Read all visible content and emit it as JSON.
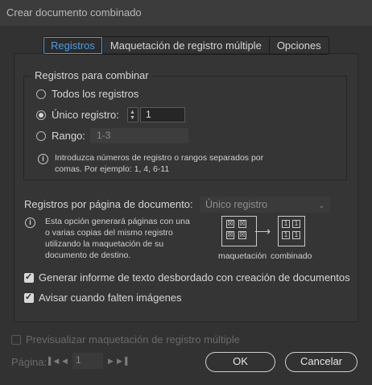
{
  "window": {
    "title": "Crear documento combinado"
  },
  "tabs": [
    {
      "label": "Registros",
      "active": true
    },
    {
      "label": "Maquetación de registro múltiple",
      "active": false
    },
    {
      "label": "Opciones",
      "active": false
    }
  ],
  "records_group": {
    "title": "Registros para combinar",
    "options": {
      "all": "Todos los registros",
      "single": "Único registro:",
      "range": "Rango:"
    },
    "selected": "single",
    "single_value": "1",
    "range_placeholder": "1-3",
    "info_line1": "Introduzca números de registro o rangos separados por",
    "info_line2": "comas. Por ejemplo: 1, 4, 6-11"
  },
  "per_page": {
    "label": "Registros por página de documento:",
    "value": "Único registro",
    "info_lines": [
      "Esta opción generará páginas con una",
      "o varias copias del mismo registro",
      "utilizando la maquetación de su",
      "documento de destino."
    ],
    "diagram_left_label": "maquetación",
    "diagram_right_label": "combinado"
  },
  "checkboxes": {
    "overset_report": {
      "label": "Generar informe de texto desbordado con creación de documentos",
      "checked": true
    },
    "missing_images": {
      "label": "Avisar cuando falten imágenes",
      "checked": true
    }
  },
  "preview": {
    "label": "Previsualizar maquetación de registro múltiple",
    "checked": false,
    "enabled": false
  },
  "pager": {
    "label": "Página:",
    "value": "1"
  },
  "buttons": {
    "ok": "OK",
    "cancel": "Cancelar"
  },
  "colors": {
    "background": "#323232",
    "accent": "#4a9be8",
    "text": "#d6d6d6"
  },
  "icons": [
    "info-icon",
    "spinner-up-icon",
    "spinner-down-icon",
    "chevron-down-icon",
    "arrow-right-icon",
    "checkmark-icon",
    "first-page-icon",
    "prev-page-icon",
    "next-page-icon",
    "last-page-icon"
  ]
}
